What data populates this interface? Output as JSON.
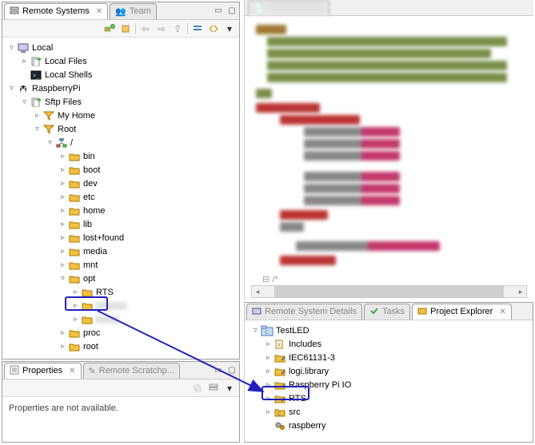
{
  "remote_systems": {
    "tab_label": "Remote Systems",
    "secondary_tab": "Team",
    "toolbar_icons": [
      "refresh-icon",
      "home-icon",
      "back-icon",
      "forward-icon",
      "sync-icon",
      "collapse-icon",
      "pin-icon",
      "menu-icon"
    ],
    "nodes": {
      "local": "Local",
      "local_files": "Local Files",
      "local_shells": "Local Shells",
      "raspberrypi": "RaspberryPi",
      "sftp_files": "Sftp Files",
      "my_home": "My Home",
      "root": "Root",
      "slash": "/",
      "folders": [
        "bin",
        "boot",
        "dev",
        "etc",
        "home",
        "lib",
        "lost+found",
        "media",
        "mnt",
        "opt"
      ],
      "rts": "RTS",
      "tail": [
        "proc",
        "root"
      ]
    }
  },
  "properties": {
    "tab_label": "Properties",
    "secondary_tab": "Remote Scratchp...",
    "message": "Properties are not available."
  },
  "bottom_tabs": {
    "remote_system_details": "Remote System Details",
    "tasks": "Tasks",
    "project_explorer": "Project Explorer"
  },
  "project_explorer": {
    "project": "TestLED",
    "items": [
      "Includes",
      "IEC61131-3",
      "logi.library",
      "Raspberry Pi IO",
      "RTS",
      "src",
      "raspberry"
    ]
  },
  "chart_data": null
}
